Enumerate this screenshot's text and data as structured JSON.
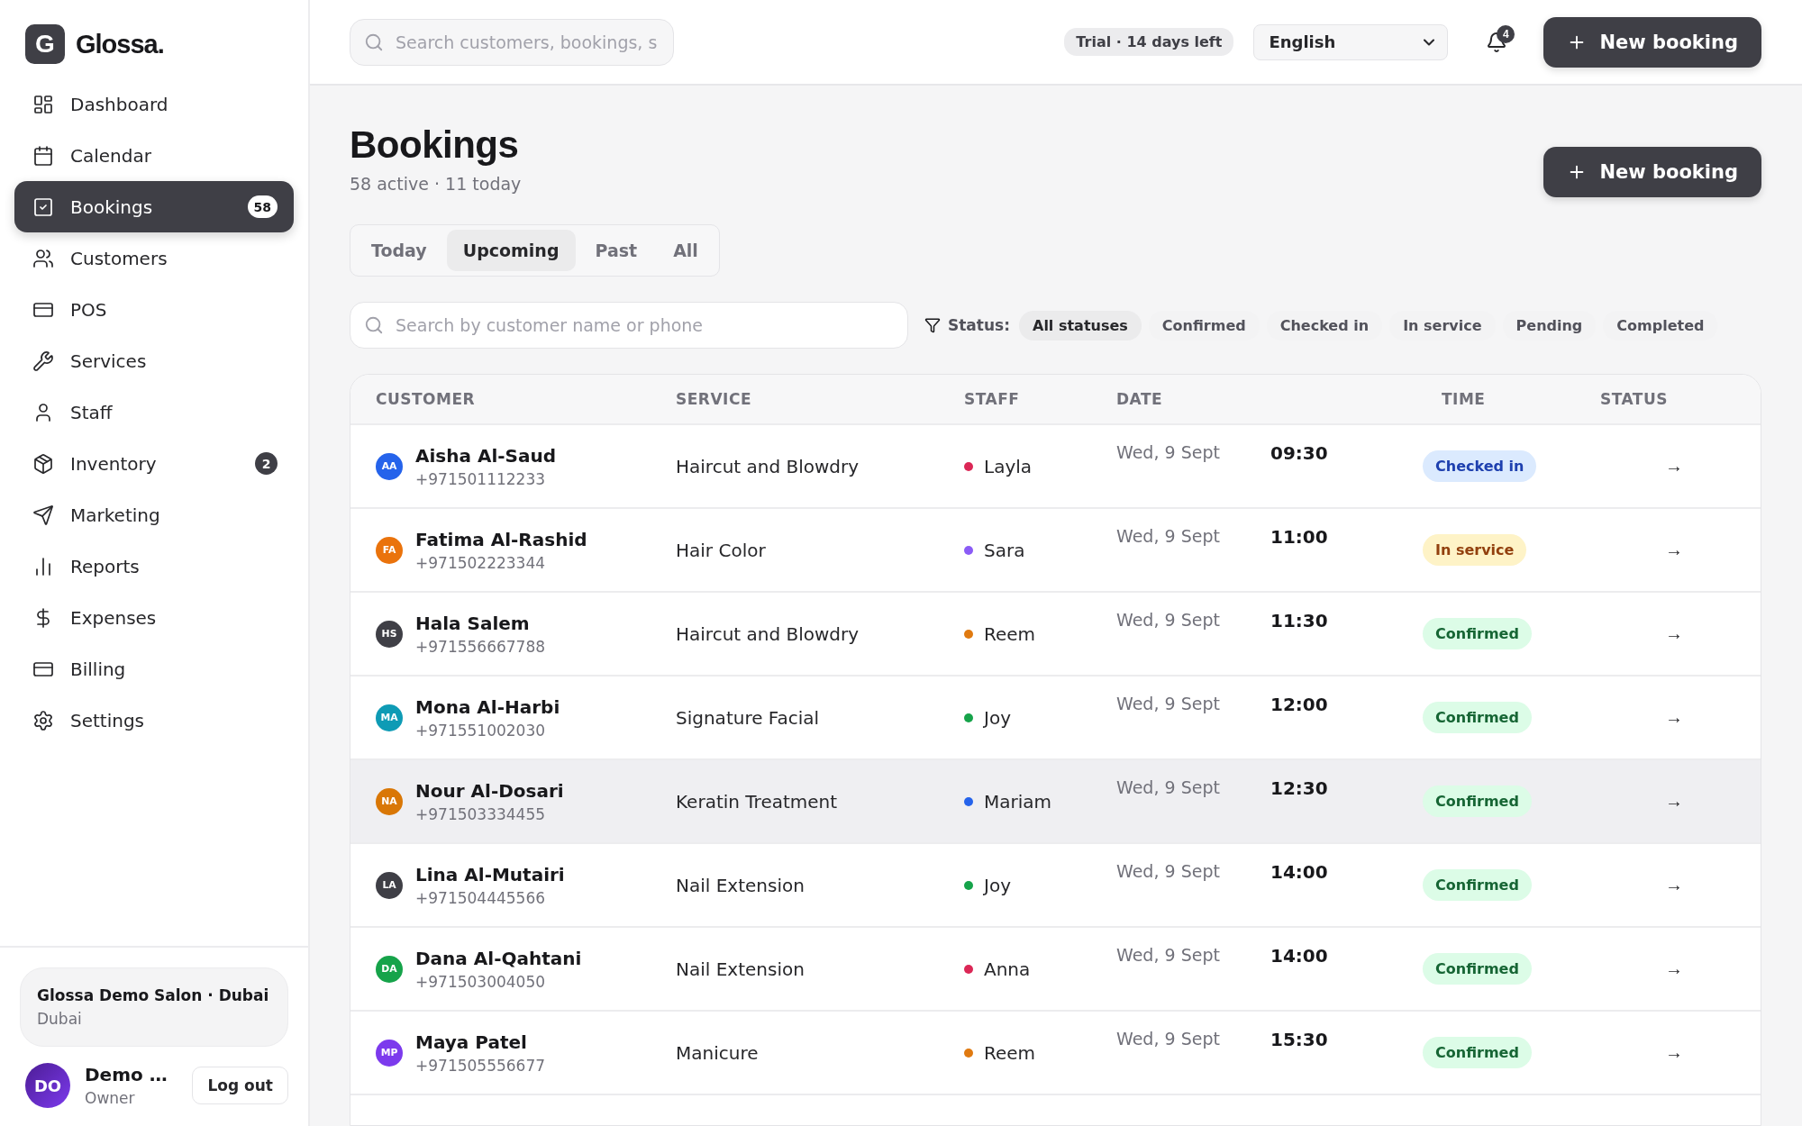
{
  "brand": {
    "mark": "G",
    "name": "Glossa."
  },
  "nav": [
    {
      "label": "Dashboard",
      "selected": false
    },
    {
      "label": "Calendar",
      "selected": false
    },
    {
      "label": "Bookings",
      "selected": true,
      "badge": "58"
    },
    {
      "label": "Customers",
      "selected": false
    },
    {
      "label": "POS",
      "selected": false
    },
    {
      "label": "Services",
      "selected": false
    },
    {
      "label": "Staff",
      "selected": false
    },
    {
      "label": "Inventory",
      "selected": false,
      "badge": "2"
    },
    {
      "label": "Marketing",
      "selected": false
    },
    {
      "label": "Reports",
      "selected": false
    },
    {
      "label": "Expenses",
      "selected": false
    },
    {
      "label": "Billing",
      "selected": false
    },
    {
      "label": "Settings",
      "selected": false
    }
  ],
  "salon": {
    "name": "Glossa Demo Salon · Dubai",
    "city": "Dubai"
  },
  "user": {
    "initials": "DO",
    "name": "Demo …",
    "role": "Owner",
    "logout": "Log out"
  },
  "topbar": {
    "search_placeholder": "Search customers, bookings, s",
    "trial": "Trial · 14 days left",
    "language": "English",
    "notifications": "4",
    "new_booking": "New booking"
  },
  "page": {
    "title": "Bookings",
    "subtitle": "58 active · 11 today",
    "new_booking": "New booking"
  },
  "tabs": [
    {
      "label": "Today",
      "selected": false
    },
    {
      "label": "Upcoming",
      "selected": true
    },
    {
      "label": "Past",
      "selected": false
    },
    {
      "label": "All",
      "selected": false
    }
  ],
  "filter": {
    "search_placeholder": "Search by customer name or phone",
    "status_label": "Status:",
    "chips": [
      {
        "label": "All statuses",
        "selected": true
      },
      {
        "label": "Confirmed",
        "selected": false
      },
      {
        "label": "Checked in",
        "selected": false
      },
      {
        "label": "In service",
        "selected": false
      },
      {
        "label": "Pending",
        "selected": false
      },
      {
        "label": "Completed",
        "selected": false
      }
    ]
  },
  "table": {
    "columns": [
      "CUSTOMER",
      "SERVICE",
      "STAFF",
      "DATE",
      "TIME",
      "STATUS"
    ],
    "rows": [
      {
        "avatar": {
          "initials": "AA",
          "color": "#2563eb"
        },
        "name": "Aisha Al-Saud",
        "phone": "+971501112233",
        "service": "Haircut and Blowdry",
        "staff": {
          "name": "Layla",
          "color": "#db2756"
        },
        "date": "Wed, 9 Sept",
        "time": "09:30",
        "status": {
          "kind": "checked_in",
          "label": "Checked in"
        },
        "arrow": "→",
        "hovered": false
      },
      {
        "avatar": {
          "initials": "FA",
          "color": "#ea730c"
        },
        "name": "Fatima Al-Rashid",
        "phone": "+971502223344",
        "service": "Hair Color",
        "staff": {
          "name": "Sara",
          "color": "#8b5cf6"
        },
        "date": "Wed, 9 Sept",
        "time": "11:00",
        "status": {
          "kind": "in_service",
          "label": "In service"
        },
        "arrow": "→",
        "hovered": false
      },
      {
        "avatar": {
          "initials": "HS",
          "color": "#3f3f46"
        },
        "name": "Hala Salem",
        "phone": "+971556667788",
        "service": "Haircut and Blowdry",
        "staff": {
          "name": "Reem",
          "color": "#e07a10"
        },
        "date": "Wed, 9 Sept",
        "time": "11:30",
        "status": {
          "kind": "confirmed",
          "label": "Confirmed"
        },
        "arrow": "→",
        "hovered": false
      },
      {
        "avatar": {
          "initials": "MA",
          "color": "#0e9bb5"
        },
        "name": "Mona Al-Harbi",
        "phone": "+971551002030",
        "service": "Signature Facial",
        "staff": {
          "name": "Joy",
          "color": "#16a34a"
        },
        "date": "Wed, 9 Sept",
        "time": "12:00",
        "status": {
          "kind": "confirmed",
          "label": "Confirmed"
        },
        "arrow": "→",
        "hovered": false
      },
      {
        "avatar": {
          "initials": "NA",
          "color": "#d97706"
        },
        "name": "Nour Al-Dosari",
        "phone": "+971503334455",
        "service": "Keratin Treatment",
        "staff": {
          "name": "Mariam",
          "color": "#2563eb"
        },
        "date": "Wed, 9 Sept",
        "time": "12:30",
        "status": {
          "kind": "confirmed",
          "label": "Confirmed"
        },
        "arrow": "→",
        "hovered": true
      },
      {
        "avatar": {
          "initials": "LA",
          "color": "#3f3f46"
        },
        "name": "Lina Al-Mutairi",
        "phone": "+971504445566",
        "service": "Nail Extension",
        "staff": {
          "name": "Joy",
          "color": "#16a34a"
        },
        "date": "Wed, 9 Sept",
        "time": "14:00",
        "status": {
          "kind": "confirmed",
          "label": "Confirmed"
        },
        "arrow": "→",
        "hovered": false
      },
      {
        "avatar": {
          "initials": "DA",
          "color": "#16a34a"
        },
        "name": "Dana Al-Qahtani",
        "phone": "+971503004050",
        "service": "Nail Extension",
        "staff": {
          "name": "Anna",
          "color": "#db2756"
        },
        "date": "Wed, 9 Sept",
        "time": "14:00",
        "status": {
          "kind": "confirmed",
          "label": "Confirmed"
        },
        "arrow": "→",
        "hovered": false
      },
      {
        "avatar": {
          "initials": "MP",
          "color": "#7c3aed"
        },
        "name": "Maya Patel",
        "phone": "+971505556677",
        "service": "Manicure",
        "staff": {
          "name": "Reem",
          "color": "#e07a10"
        },
        "date": "Wed, 9 Sept",
        "time": "15:30",
        "status": {
          "kind": "confirmed",
          "label": "Confirmed"
        },
        "arrow": "→",
        "hovered": false
      }
    ]
  }
}
